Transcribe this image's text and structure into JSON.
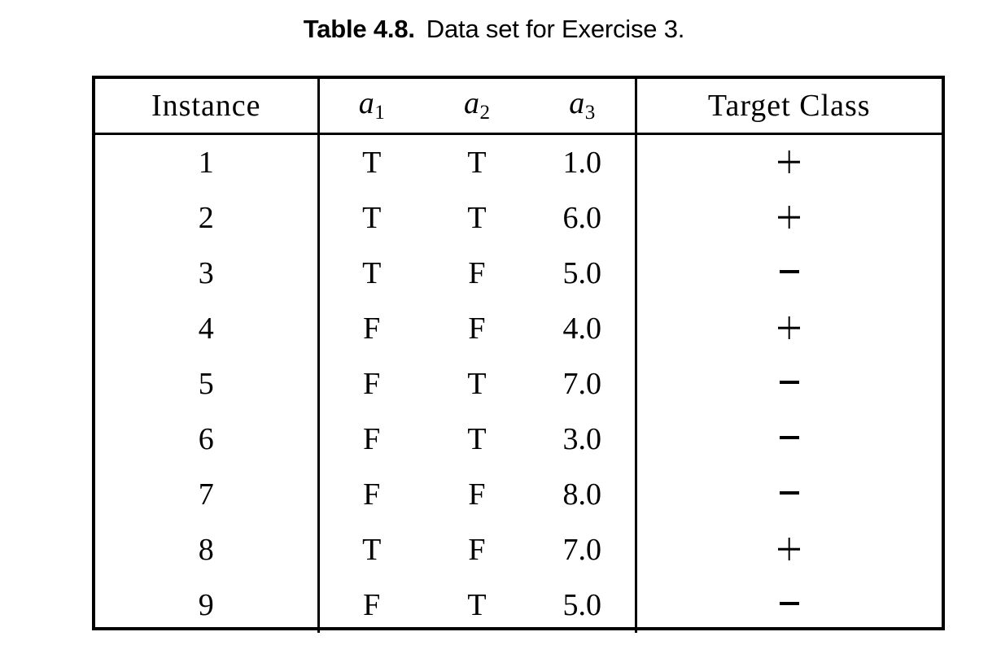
{
  "caption": {
    "label": "Table 4.8.",
    "text": "Data set for Exercise 3."
  },
  "table": {
    "columns": [
      {
        "key": "instance",
        "header": "Instance"
      },
      {
        "key": "a1",
        "header": "a",
        "subscript": "1"
      },
      {
        "key": "a2",
        "header": "a",
        "subscript": "2"
      },
      {
        "key": "a3",
        "header": "a",
        "subscript": "3"
      },
      {
        "key": "target",
        "header": "Target Class"
      }
    ],
    "headers": {
      "instance": "Instance",
      "a1_base": "a",
      "a1_sub": "1",
      "a2_base": "a",
      "a2_sub": "2",
      "a3_base": "a",
      "a3_sub": "3",
      "target": "Target Class"
    },
    "rows": [
      {
        "instance": "1",
        "a1": "T",
        "a2": "T",
        "a3": "1.0",
        "target": "+"
      },
      {
        "instance": "2",
        "a1": "T",
        "a2": "T",
        "a3": "6.0",
        "target": "+"
      },
      {
        "instance": "3",
        "a1": "T",
        "a2": "F",
        "a3": "5.0",
        "target": "−"
      },
      {
        "instance": "4",
        "a1": "F",
        "a2": "F",
        "a3": "4.0",
        "target": "+"
      },
      {
        "instance": "5",
        "a1": "F",
        "a2": "T",
        "a3": "7.0",
        "target": "−"
      },
      {
        "instance": "6",
        "a1": "F",
        "a2": "T",
        "a3": "3.0",
        "target": "−"
      },
      {
        "instance": "7",
        "a1": "F",
        "a2": "F",
        "a3": "8.0",
        "target": "−"
      },
      {
        "instance": "8",
        "a1": "T",
        "a2": "F",
        "a3": "7.0",
        "target": "+"
      },
      {
        "instance": "9",
        "a1": "F",
        "a2": "T",
        "a3": "5.0",
        "target": "−"
      }
    ]
  },
  "colors": {
    "text": "#000000",
    "background": "#ffffff",
    "rule": "#000000"
  }
}
